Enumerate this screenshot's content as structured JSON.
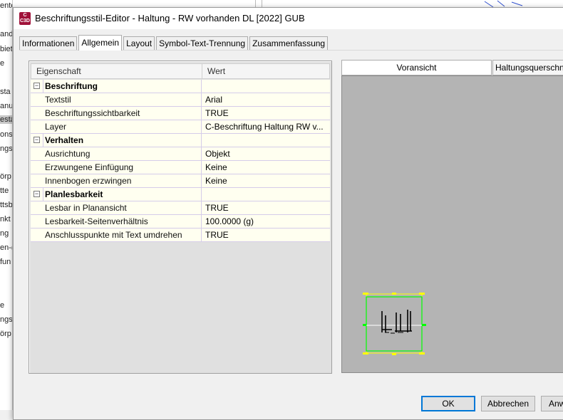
{
  "window": {
    "title": "Beschriftungsstil-Editor - Haltung - RW vorhanden DL [2022] GUB",
    "icon_label": "C\nC3D"
  },
  "background_fragments": [
    "enten",
    "and",
    "biet",
    "e",
    "sta",
    "anu",
    "esta",
    "onsp",
    "ngs",
    "örp",
    "tte",
    "ttsb",
    "nkt",
    "ng",
    "en-(",
    "fun",
    "e",
    "ngs",
    "örp"
  ],
  "tabs": [
    {
      "label": "Informationen",
      "active": false
    },
    {
      "label": "Allgemein",
      "active": true
    },
    {
      "label": "Layout",
      "active": false
    },
    {
      "label": "Symbol-Text-Trennung",
      "active": false
    },
    {
      "label": "Zusammenfassung",
      "active": false
    }
  ],
  "grid": {
    "col_property": "Eigenschaft",
    "col_value": "Wert",
    "categories": [
      {
        "label": "Beschriftung",
        "expander": "⊟",
        "rows": [
          {
            "name": "Textstil",
            "value": "Arial"
          },
          {
            "name": "Beschriftungssichtbarkeit",
            "value": "TRUE"
          },
          {
            "name": "Layer",
            "value": "C-Beschriftung Haltung RW v..."
          }
        ]
      },
      {
        "label": "Verhalten",
        "expander": "⊟",
        "rows": [
          {
            "name": "Ausrichtung",
            "value": "Objekt"
          },
          {
            "name": "Erzwungene Einfügung",
            "value": "Keine"
          },
          {
            "name": "Innenbogen erzwingen",
            "value": "Keine"
          }
        ]
      },
      {
        "label": "Planlesbarkeit",
        "expander": "⊟",
        "rows": [
          {
            "name": "Lesbar in Planansicht",
            "value": "TRUE"
          },
          {
            "name": "Lesbarkeit-Seitenverhältnis",
            "value": "100.0000 (g)"
          },
          {
            "name": "Anschlusspunkte mit Text umdrehen",
            "value": "TRUE"
          }
        ]
      }
    ]
  },
  "preview": {
    "tab1": "Voransicht",
    "tab2": "Haltungsquerschnitt"
  },
  "buttons": {
    "ok": "OK",
    "cancel": "Abbrechen",
    "apply": "Anw"
  },
  "colors": {
    "row_bg": "#fffff0",
    "row_border": "#d5cce9",
    "preview_bg": "#b4b4b4",
    "preview_box": "#ffff00",
    "preview_frame": "#00ff00"
  }
}
